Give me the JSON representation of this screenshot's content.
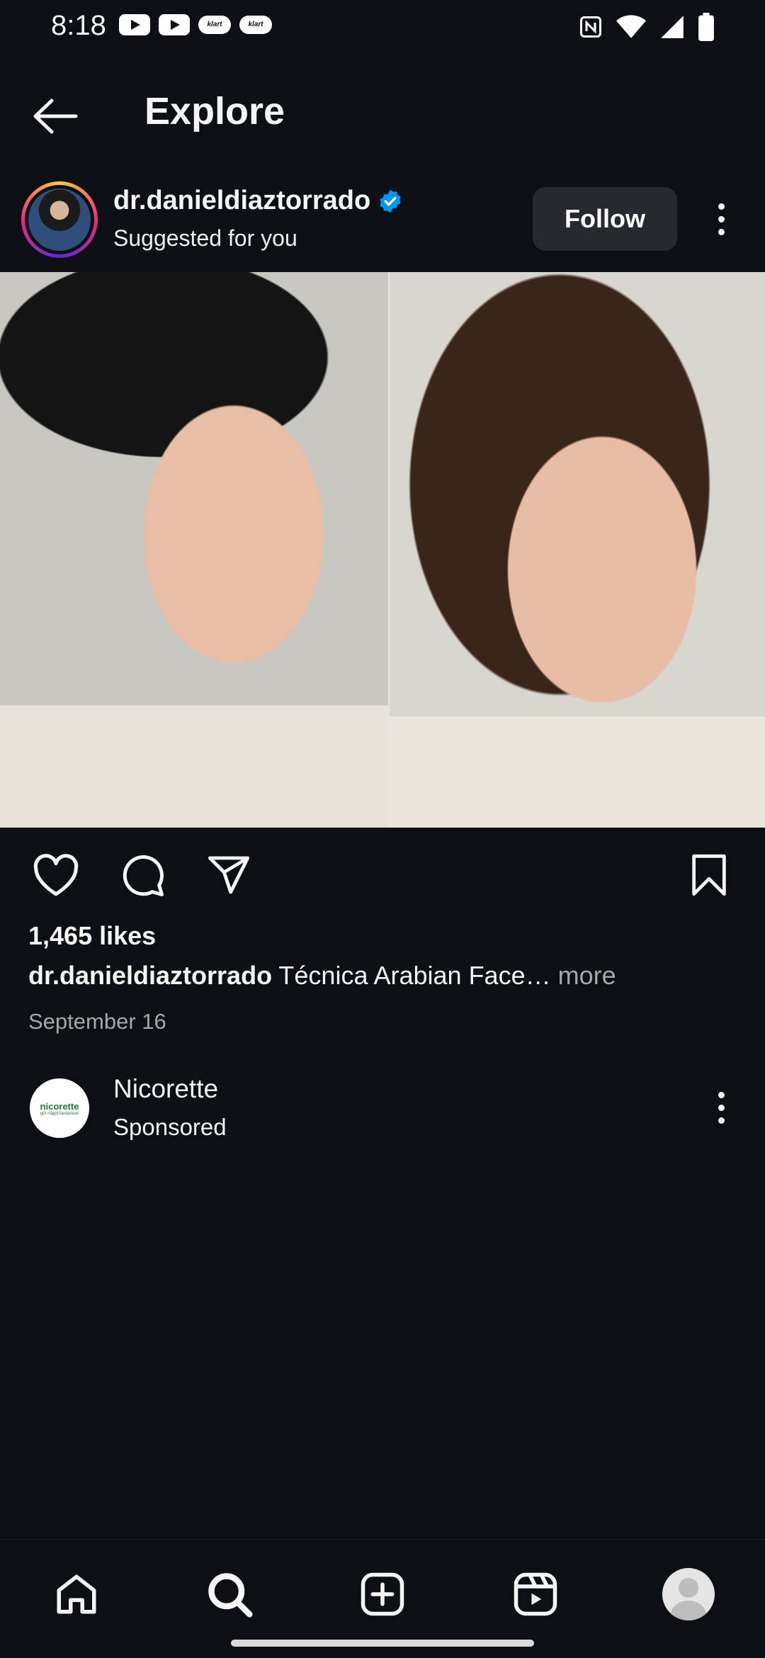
{
  "status_bar": {
    "time": "8:18",
    "left_icons": [
      "youtube-icon",
      "youtube-icon",
      "klart-icon",
      "klart-icon"
    ],
    "klart_label": "klart",
    "right_icons": [
      "nfc-icon",
      "wifi-icon",
      "signal-icon",
      "battery-icon"
    ]
  },
  "header": {
    "title": "Explore",
    "back_icon": "arrow-left-icon"
  },
  "post": {
    "username": "dr.danieldiaztorrado",
    "verified": true,
    "subtitle": "Suggested for you",
    "follow_label": "Follow",
    "likes": "1,465 likes",
    "caption_user": "dr.danieldiaztorrado",
    "caption_text": " Técnica Arabian Face…",
    "caption_more": " more",
    "date": "September 16"
  },
  "sponsored": {
    "name": "Nicorette",
    "subtitle": "Sponsored",
    "logo_text": "nicorette",
    "logo_tag": "gör något fantastiskt"
  },
  "bottom_nav": {
    "items": [
      "home-icon",
      "search-icon",
      "create-icon",
      "reels-icon",
      "profile-avatar"
    ]
  },
  "colors": {
    "background": "#0c1014",
    "follow_button": "#262a2f",
    "verified_blue": "#0095f6",
    "muted_text": "#a8a8a8"
  }
}
